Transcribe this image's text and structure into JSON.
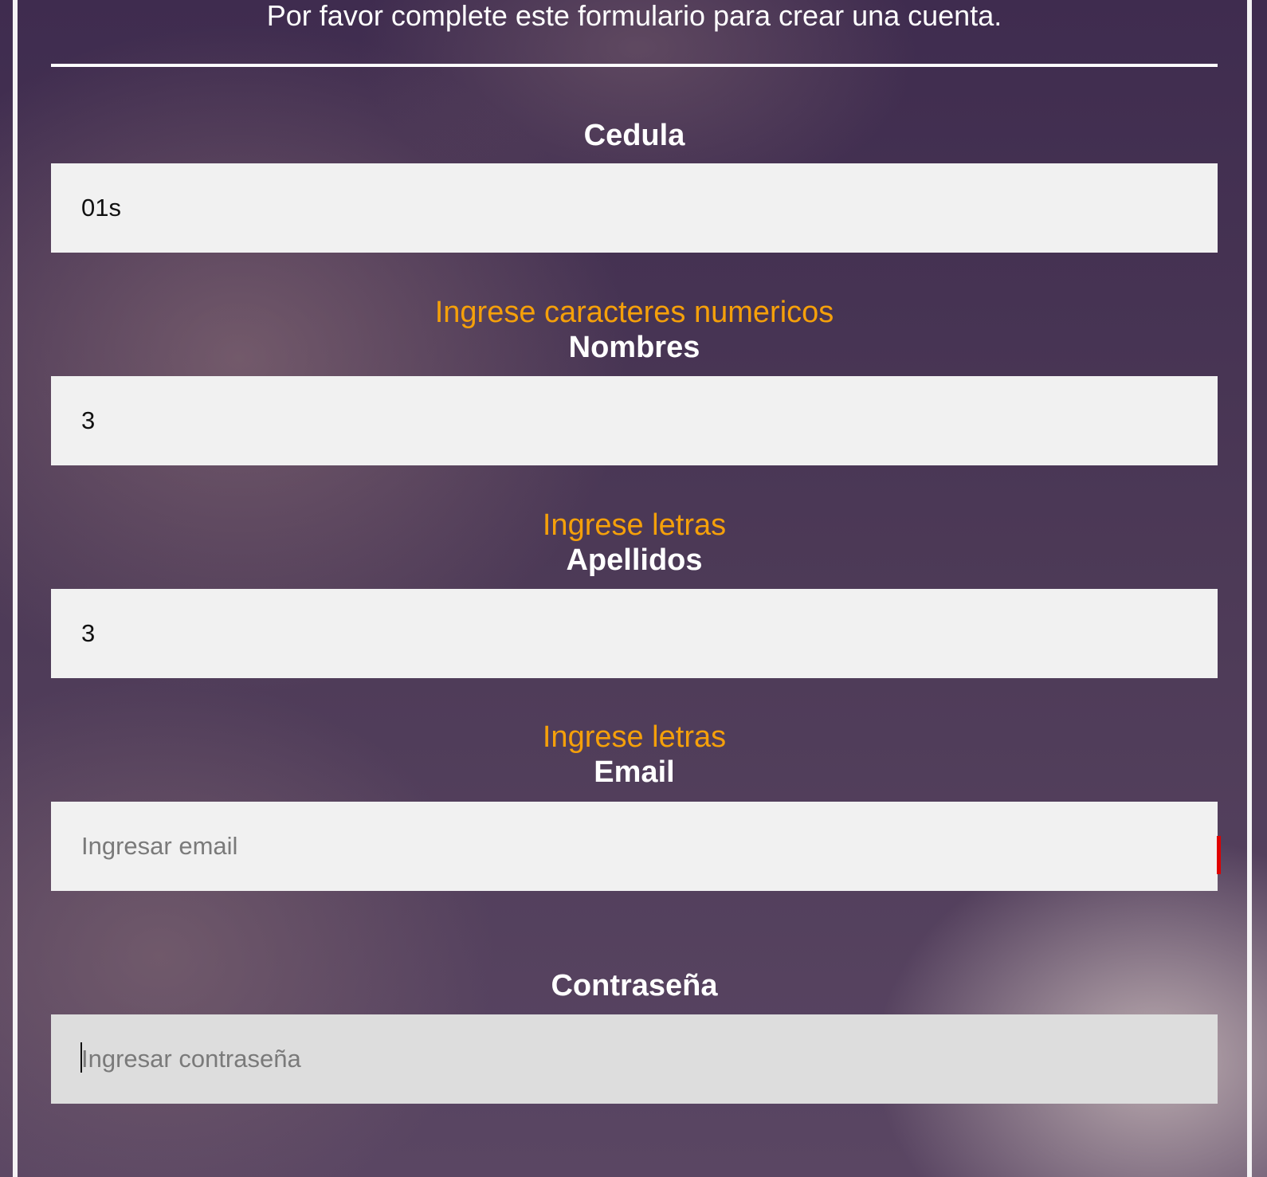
{
  "form": {
    "intro": "Por favor complete este formulario para crear una cuenta.",
    "fields": {
      "cedula": {
        "label": "Cedula",
        "value": "01s",
        "hint": "Ingrese caracteres numericos"
      },
      "nombres": {
        "label": "Nombres",
        "value": "3",
        "hint": "Ingrese letras"
      },
      "apellidos": {
        "label": "Apellidos",
        "value": "3",
        "hint": "Ingrese letras"
      },
      "email": {
        "label": "Email",
        "value": "",
        "placeholder": "Ingresar email"
      },
      "password": {
        "label": "Contraseña",
        "value": "",
        "placeholder": "Ingresar contraseña"
      }
    }
  },
  "colors": {
    "hint": "#f5a00a",
    "label": "#ffffff",
    "field_bg": "#f1f1f1",
    "field_focused_bg": "#dddddd",
    "error_marker": "#e00000"
  }
}
